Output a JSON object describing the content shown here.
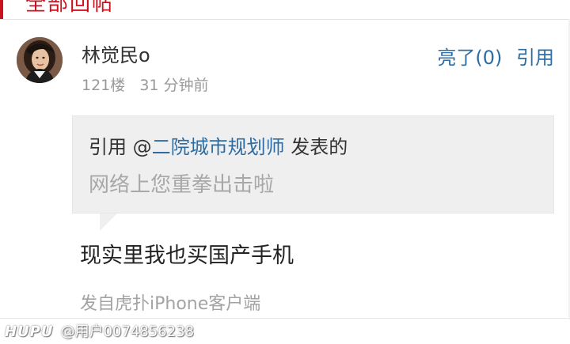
{
  "header": {
    "cut_title": "全部回帖"
  },
  "post": {
    "username": "林觉民o",
    "floor": "121楼",
    "time": "31 分钟前",
    "actions": {
      "light": "亮了(0)",
      "quote": "引用"
    },
    "quote_box": {
      "prefix": "引用 @",
      "quoted_user": "二院城市规划师",
      "suffix": " 发表的",
      "quoted_text": "网络上您重拳出击啦"
    },
    "body": "现实里我也买国产手机",
    "source": "发自虎扑iPhone客户端"
  },
  "watermark": {
    "logo": "HUPU",
    "handle": "@用户0074856238"
  },
  "colors": {
    "brand_red": "#c8121e",
    "link_blue": "#2e6da4",
    "quote_bg": "#efefef"
  }
}
